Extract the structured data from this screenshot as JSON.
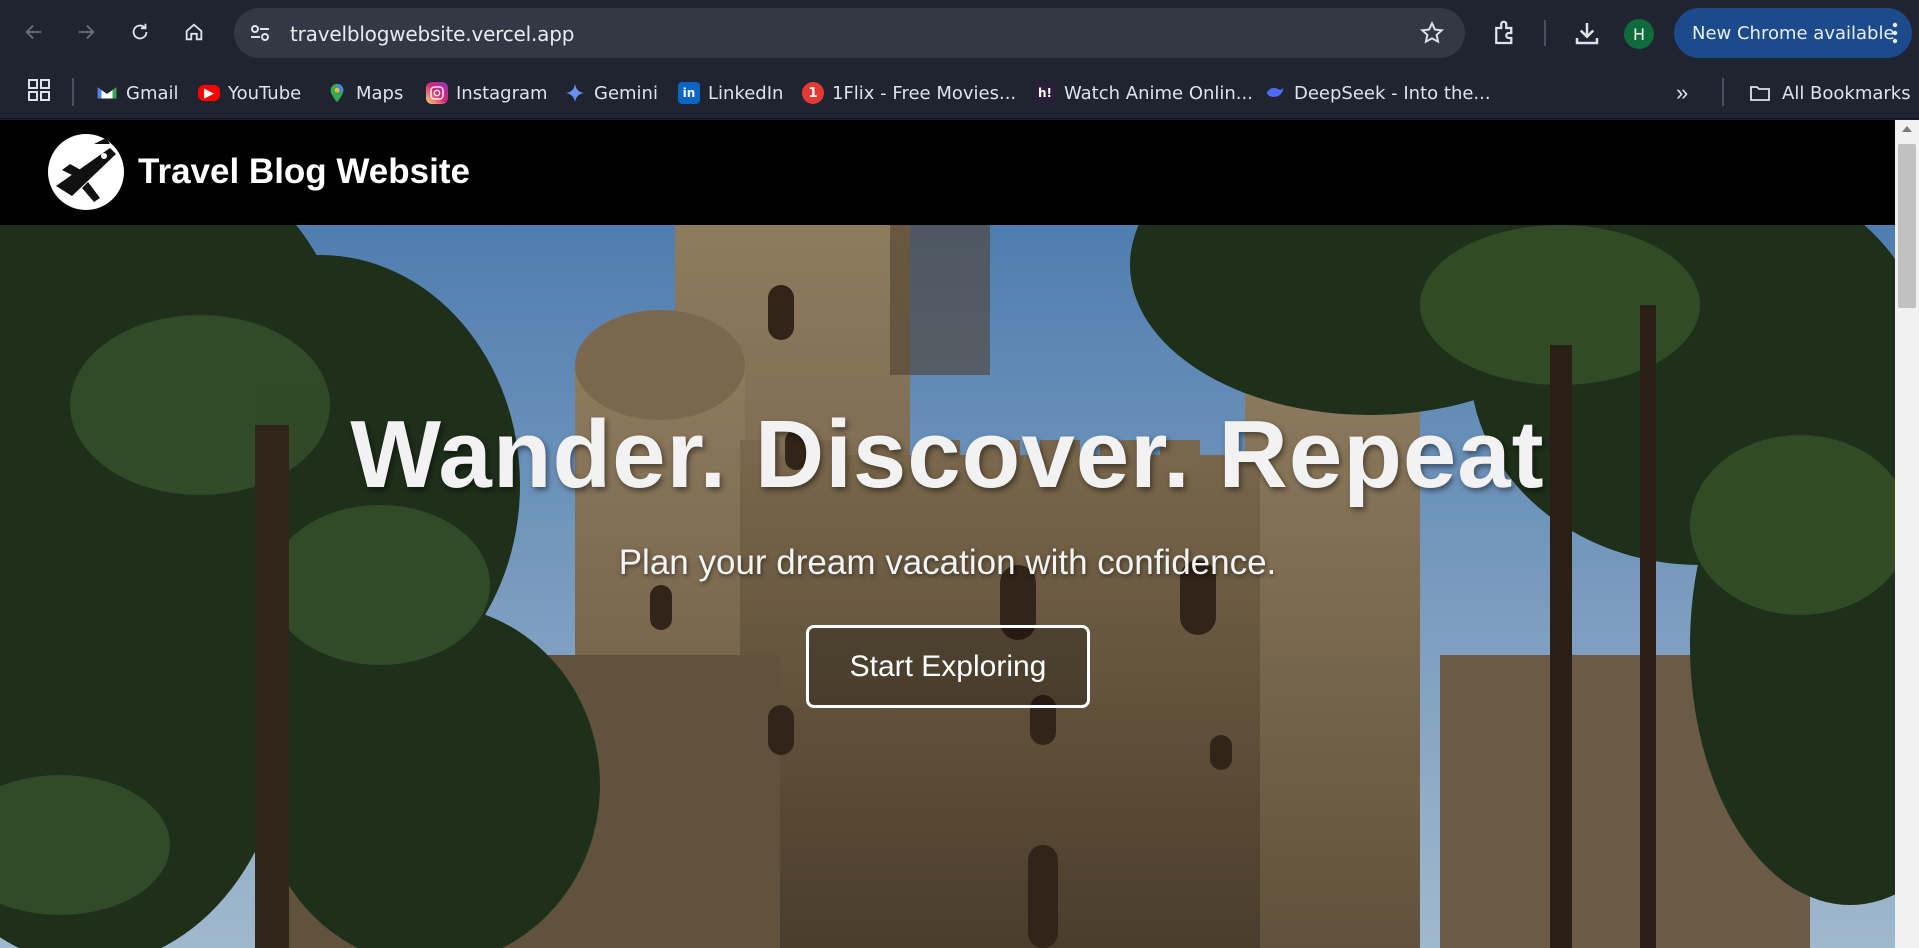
{
  "browser": {
    "url": "travelblogwebsite.vercel.app",
    "profile_initial": "H",
    "update_label": "New Chrome available",
    "bookmarks": [
      {
        "label": "Gmail",
        "icon": "gmail-icon"
      },
      {
        "label": "YouTube",
        "icon": "youtube-icon"
      },
      {
        "label": "Maps",
        "icon": "maps-icon"
      },
      {
        "label": "Instagram",
        "icon": "instagram-icon"
      },
      {
        "label": "Gemini",
        "icon": "gemini-icon"
      },
      {
        "label": "LinkedIn",
        "icon": "linkedin-icon"
      },
      {
        "label": "1Flix - Free Movies...",
        "icon": "1flix-icon"
      },
      {
        "label": "Watch Anime Onlin...",
        "icon": "hianime-icon"
      },
      {
        "label": "DeepSeek - Into the...",
        "icon": "deepseek-icon"
      }
    ],
    "all_bookmarks_label": "All Bookmarks",
    "more_label": "»"
  },
  "site": {
    "title": "Travel Blog Website"
  },
  "hero": {
    "title": "Wander. Discover. Repeat",
    "subtitle": "Plan your dream vacation with confidence.",
    "cta_label": "Start Exploring"
  },
  "colors": {
    "chrome_bg": "#1f2430",
    "omnibox_bg": "#323844",
    "update_pill": "#1c4a8a",
    "site_header": "#000000"
  }
}
